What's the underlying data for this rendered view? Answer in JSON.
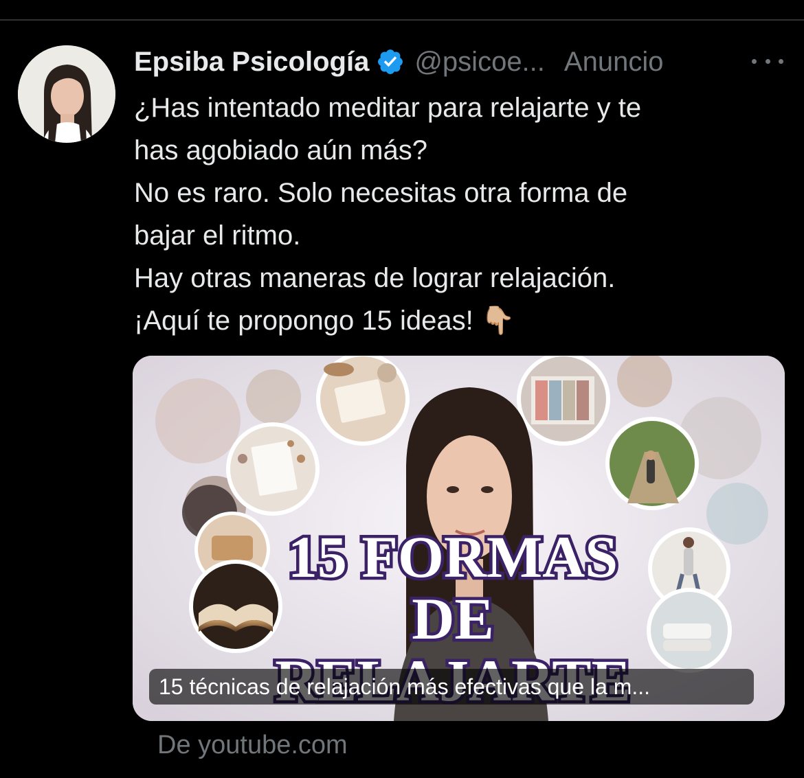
{
  "tweet": {
    "author": {
      "display_name": "Epsiba Psicología",
      "handle": "@psicoe...",
      "verified_color": "#1d9bf0"
    },
    "promoted_label": "Anuncio",
    "more_icon": "more-horizontal-icon",
    "text_lines": [
      "¿Has intentado meditar para relajarte y te",
      "has agobiado aún más?",
      "No es raro. Solo necesitas otra forma de",
      "bajar el ritmo.",
      "Hay otras maneras de lograr relajación.",
      "¡Aquí te propongo 15 ideas! 👇🏼"
    ],
    "card": {
      "thumbnail_heading": [
        "15 FORMAS",
        "DE",
        "RELAJARTE"
      ],
      "title": "15 técnicas de relajación más efectivas que la m...",
      "source": "De youtube.com"
    }
  },
  "colors": {
    "background": "#000000",
    "text_primary": "#e7e9ea",
    "text_secondary": "#71767b",
    "divider": "#2f3336",
    "thumbnail_text_fill": "#ffffff",
    "thumbnail_text_stroke": "#3b2266"
  }
}
